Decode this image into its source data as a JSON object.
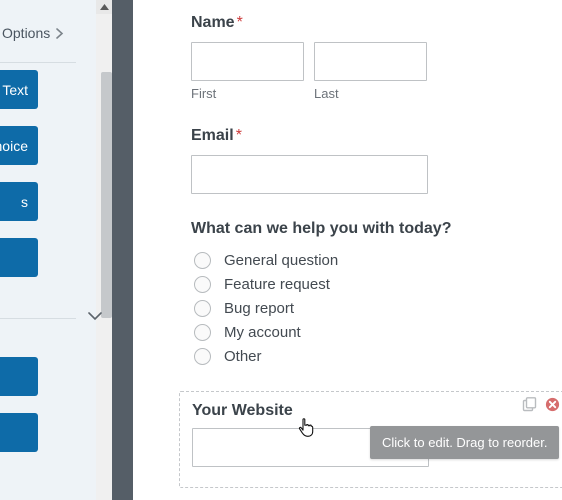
{
  "sidebar": {
    "options_label": "Options",
    "pills": [
      "h Text",
      "Choice",
      "s",
      ""
    ],
    "bottom_pills": [
      "",
      ""
    ]
  },
  "form": {
    "name": {
      "label": "Name",
      "first_sub": "First",
      "last_sub": "Last"
    },
    "email": {
      "label": "Email"
    },
    "question": {
      "label": "What can we help you with today?",
      "options": [
        "General question",
        "Feature request",
        "Bug report",
        "My account",
        "Other"
      ]
    },
    "website": {
      "label": "Your Website"
    }
  },
  "tooltip": "Click to edit. Drag to reorder.",
  "asterisk": "*"
}
